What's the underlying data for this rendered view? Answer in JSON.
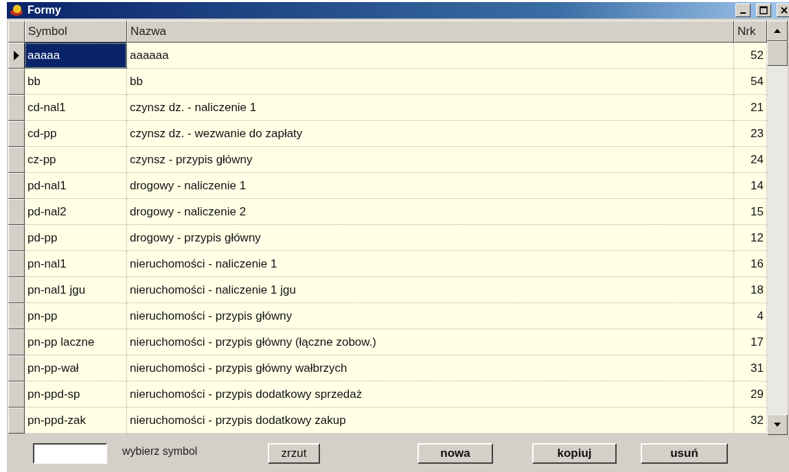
{
  "window": {
    "title": "Formy"
  },
  "table": {
    "columns": [
      "Symbol",
      "Nazwa",
      "Nrk"
    ],
    "rows": [
      {
        "symbol": "aaaaa",
        "name": "aaaaaa",
        "nrk": "52",
        "selected": true
      },
      {
        "symbol": "bb",
        "name": "bb",
        "nrk": "54",
        "selected": false
      },
      {
        "symbol": "cd-nal1",
        "name": "czynsz dz. - naliczenie 1",
        "nrk": "21",
        "selected": false
      },
      {
        "symbol": "cd-pp",
        "name": "czynsz dz. - wezwanie do zapłaty",
        "nrk": "23",
        "selected": false
      },
      {
        "symbol": "cz-pp",
        "name": "czynsz - przypis główny",
        "nrk": "24",
        "selected": false
      },
      {
        "symbol": "pd-nal1",
        "name": "drogowy - naliczenie 1",
        "nrk": "14",
        "selected": false
      },
      {
        "symbol": "pd-nal2",
        "name": "drogowy - naliczenie 2",
        "nrk": "15",
        "selected": false
      },
      {
        "symbol": "pd-pp",
        "name": "drogowy - przypis główny",
        "nrk": "12",
        "selected": false
      },
      {
        "symbol": "pn-nal1",
        "name": "nieruchomości - naliczenie 1",
        "nrk": "16",
        "selected": false
      },
      {
        "symbol": "pn-nal1 jgu",
        "name": "nieruchomości - naliczenie 1 jgu",
        "nrk": "18",
        "selected": false
      },
      {
        "symbol": "pn-pp",
        "name": "nieruchomości - przypis główny",
        "nrk": "4",
        "selected": false
      },
      {
        "symbol": "pn-pp laczne",
        "name": "nieruchomości - przypis główny (łączne zobow.)",
        "nrk": "17",
        "selected": false
      },
      {
        "symbol": "pn-pp-wał",
        "name": "nieruchomości - przypis główny wałbrzych",
        "nrk": "31",
        "selected": false
      },
      {
        "symbol": "pn-ppd-sp",
        "name": "nieruchomości - przypis dodatkowy sprzedaż",
        "nrk": "29",
        "selected": false
      },
      {
        "symbol": "pn-ppd-zak",
        "name": "nieruchomości - przypis dodatkowy zakup",
        "nrk": "32",
        "selected": false
      }
    ]
  },
  "footer": {
    "symbol_field": {
      "label": "wybierz symbol"
    },
    "buttons": [
      {
        "label": "zrzut",
        "bold": false
      },
      {
        "label": "nowa",
        "bold": true
      },
      {
        "label": "kopiuj",
        "bold": true
      },
      {
        "label": "usuń",
        "bold": true
      }
    ]
  }
}
